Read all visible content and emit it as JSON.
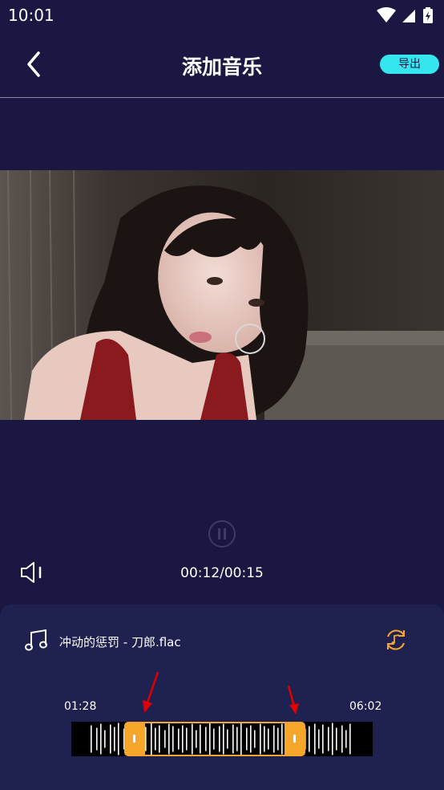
{
  "status_bar": {
    "time": "10:01"
  },
  "header": {
    "title": "添加音乐",
    "export_label": "导出"
  },
  "player": {
    "time_display": "00:12/00:15"
  },
  "music": {
    "track_name": "冲动的惩罚 - 刀郎.flac",
    "start_time": "01:28",
    "end_time": "06:02"
  },
  "colors": {
    "background": "#1a1842",
    "panel": "#1f2150",
    "accent_cyan": "#35e5f0",
    "accent_orange": "#f7a62c",
    "annotation_red": "#e00000"
  }
}
